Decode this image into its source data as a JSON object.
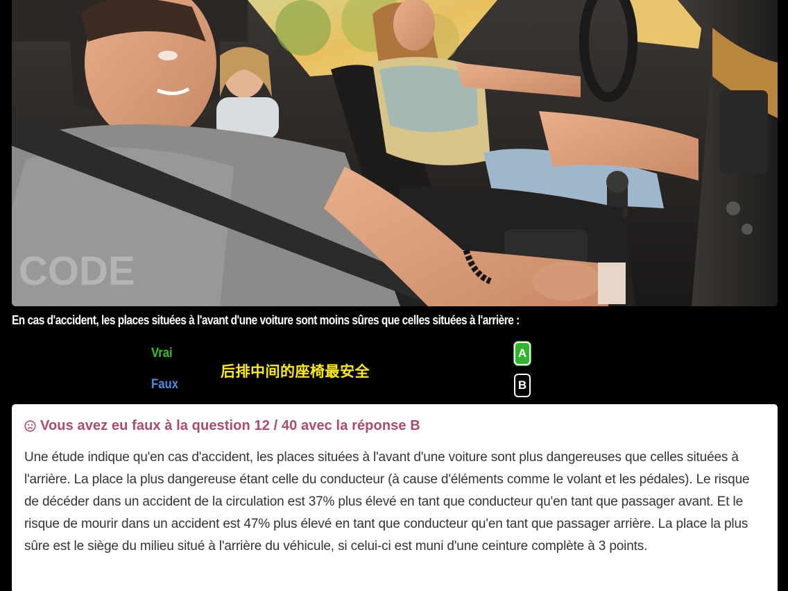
{
  "photo": {
    "alt": "",
    "watermark_text": "CODE"
  },
  "question": {
    "text": "En cas d'accident, les places situées à l'avant d'une voiture sont moins sûres que celles situées à l'arrière :"
  },
  "answers": [
    {
      "letter": "A",
      "label": "Vrai",
      "state": "selected-correct",
      "color": "#39c21b"
    },
    {
      "letter": "B",
      "label": "Faux",
      "state": "unselected",
      "color": "#4a8be0"
    }
  ],
  "hint": {
    "text": "后排中间的座椅最安全"
  },
  "result": {
    "icon": "frown-icon",
    "title": "Vous avez eu faux à la question 12 / 40 avec la réponse B",
    "explanation": "Une étude indique qu'en cas d'accident, les places situées à l'avant d'une voiture sont plus dangereuses que celles situées à l'arrière. La place la plus dangereuse étant celle du conducteur (à cause d'éléments comme le volant et les pédales). Le risque de décéder dans un accident de la circulation est 37% plus élevé en tant que conducteur qu'en tant que passager avant. Et le risque de mourir dans un accident est 47% plus élevé en tant que conducteur qu'en tant que passager arrière. La place la plus sûre est le siège du milieu situé à l'arrière du véhicule, si celui-ci est muni d'une ceinture complète à 3 points."
  },
  "colors": {
    "background": "#000000",
    "title": "#b04a6b",
    "correct_button": "#2fb52a",
    "hint": "#ffee00"
  }
}
